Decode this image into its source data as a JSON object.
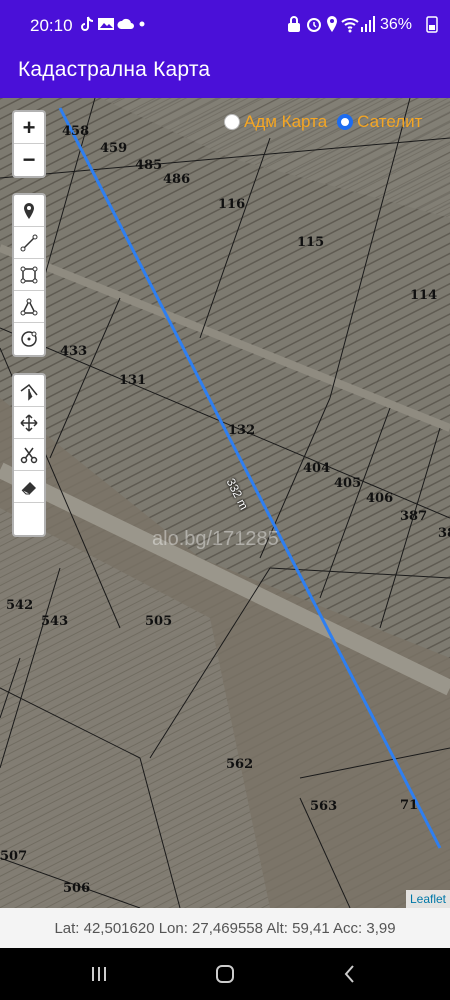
{
  "status_bar": {
    "time": "20:10",
    "battery": "36%",
    "icons": [
      "tiktok-icon",
      "gallery-icon",
      "cloud-icon",
      "dot-icon",
      "lock-icon",
      "alarm-icon",
      "location-icon",
      "wifi-icon",
      "signal-icon",
      "battery-icon"
    ]
  },
  "app_bar": {
    "title": "Кадастрална Карта"
  },
  "map": {
    "layers": [
      {
        "label": "Адм Карта",
        "checked": false
      },
      {
        "label": "Сателит",
        "checked": true
      }
    ],
    "measurement": "332 m",
    "watermark": "alo.bg/171285",
    "attribution": "Leaflet",
    "parcels": [
      "458",
      "459",
      "485",
      "486",
      "116",
      "115",
      "114",
      "433",
      "131",
      "132",
      "404",
      "405",
      "406",
      "387",
      "38",
      "542",
      "543",
      "505",
      "562",
      "563",
      "71",
      "507",
      "506"
    ],
    "zoom_controls": {
      "in": "+",
      "out": "−"
    },
    "draw_tools": [
      "marker-icon",
      "polyline-icon",
      "rectangle-icon",
      "polygon-icon",
      "circle-icon"
    ],
    "edit_tools": [
      "cut-line-icon",
      "move-icon",
      "scissors-icon",
      "eraser-icon"
    ],
    "line_color": "#2f7ff0"
  },
  "coords": {
    "text": "Lat: 42,501620 Lon: 27,469558 Alt: 59,41 Acc: 3,99"
  },
  "colors": {
    "app_bar": "#4a10d8",
    "layer_text": "#f5a623"
  }
}
